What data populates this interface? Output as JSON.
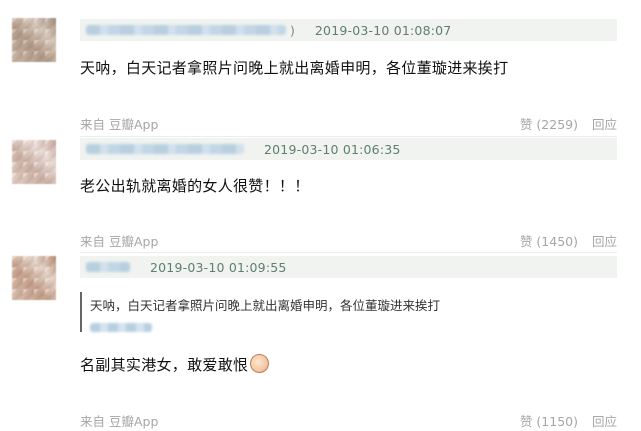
{
  "comments": [
    {
      "paren": ")",
      "timestamp": "2019-03-10 01:08:07",
      "text": "天呐，白天记者拿照片问晚上就出离婚申明，各位董璇进来挨打",
      "source": "来自 豆瓣App",
      "like_label": "赞 (2259)",
      "reply_label": "回应"
    },
    {
      "timestamp": "2019-03-10 01:06:35",
      "text": "老公出轨就离婚的女人很赞！！！",
      "source": "来自 豆瓣App",
      "like_label": "赞 (1450)",
      "reply_label": "回应"
    },
    {
      "timestamp": "2019-03-10 01:09:55",
      "quoted_text": "天呐，白天记者拿照片问晚上就出离婚申明，各位董璇进来挨打",
      "text": "名副其实港女，敢爱敢恨",
      "emoji": "clapping-hands-icon",
      "source": "来自 豆瓣App",
      "like_label": "赞 (1150)",
      "reply_label": "回应"
    }
  ],
  "colors": {
    "meta_bg": "#f0f3f0",
    "timestamp": "#5f7f6b",
    "footer_text": "#a6a6a6"
  }
}
